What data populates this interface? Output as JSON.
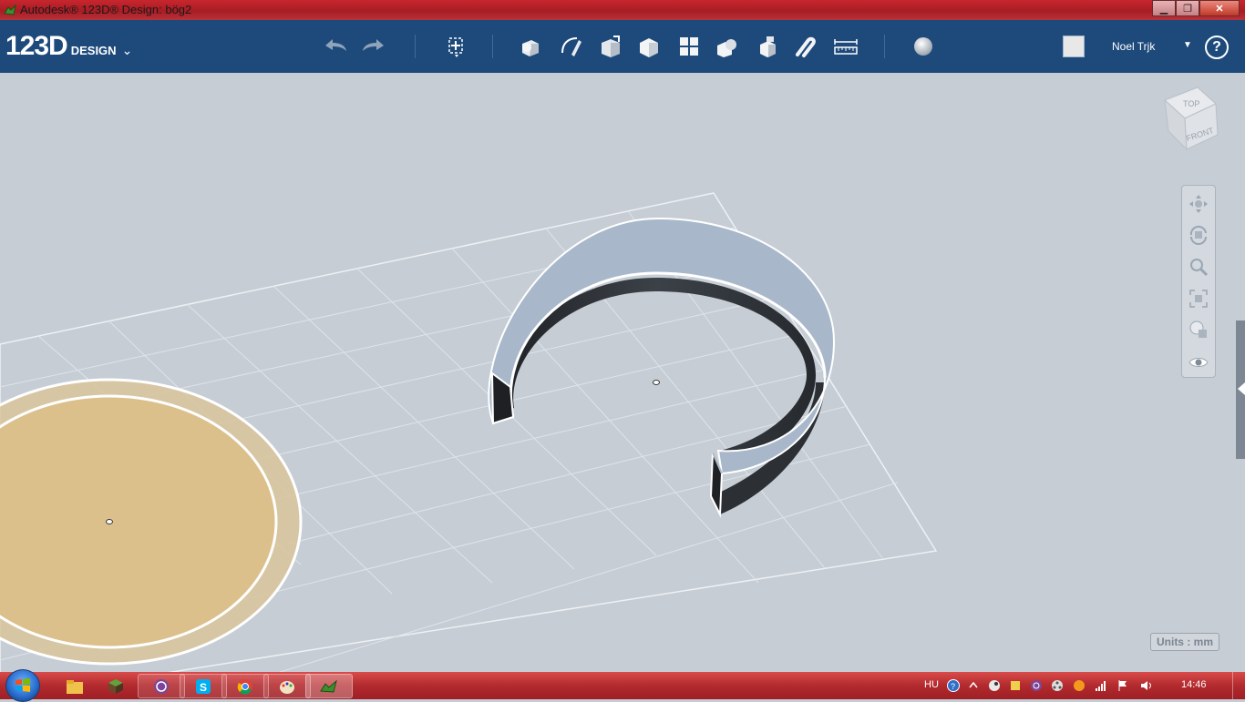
{
  "window": {
    "title": "Autodesk® 123D® Design: bög2",
    "minimize_label": "▁",
    "maximize_label": "❐",
    "close_label": "✕"
  },
  "app": {
    "logo_main": "123D",
    "logo_sub": "DESIGN",
    "logo_menu": "⌄",
    "user_name": "Noel Trjk",
    "user_dropdown": "▼",
    "help_label": "?"
  },
  "toolbar": {
    "tools": [
      "undo-icon",
      "redo-icon",
      "transform-icon",
      "primitives-icon",
      "sketch-icon",
      "construct-icon",
      "modify-icon",
      "pattern-icon",
      "grouping-icon",
      "combine-icon",
      "snap-icon",
      "measure-icon",
      "material-icon"
    ]
  },
  "viewcube": {
    "top_label": "TOP",
    "front_label": "FRONT"
  },
  "nav": {
    "items": [
      "pan-icon",
      "orbit-icon",
      "zoom-icon",
      "fit-icon",
      "view-mode-icon",
      "visibility-icon"
    ]
  },
  "units": {
    "label": "Units : mm"
  },
  "taskbar": {
    "apps": [
      "explorer-icon",
      "minecraft-icon",
      "tor-browser-icon",
      "skype-icon",
      "chrome-icon",
      "paint-icon",
      "123d-design-icon"
    ],
    "language": "HU",
    "clock": "14:46"
  },
  "colors": {
    "appbar": "#1d4a7b",
    "viewport": "#c6cdd5",
    "selected_sketch": "#dfc18a",
    "ring_top": "#aab8c8",
    "ring_inner": "#2a2d32",
    "taskbar": "#b22a2e"
  }
}
